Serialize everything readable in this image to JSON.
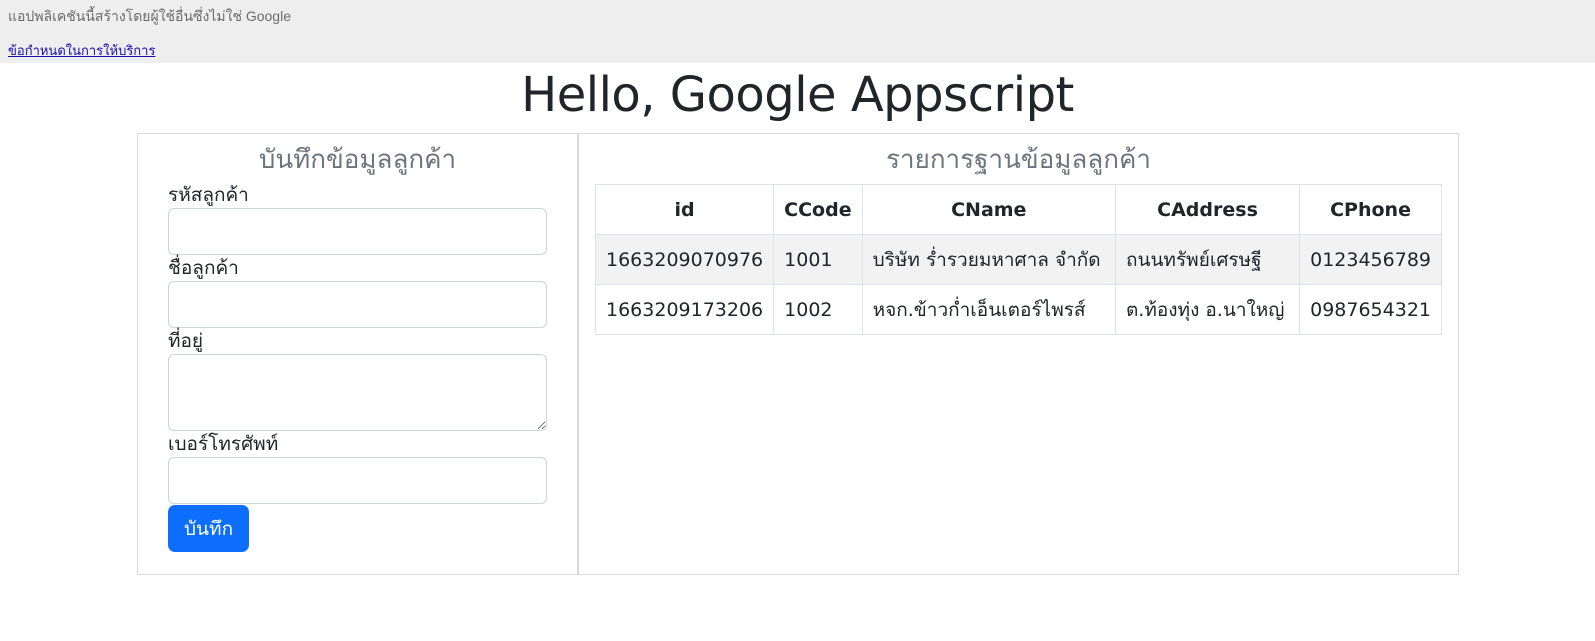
{
  "google_bar": {
    "notice": "แอปพลิเคชันนี้สร้างโดยผู้ใช้อื่นซึ่งไม่ใช่ Google",
    "terms_link": "ข้อกำหนดในการให้บริการ"
  },
  "page": {
    "title": "Hello, Google Appscript"
  },
  "form": {
    "title": "บันทึกข้อมูลลูกค้า",
    "fields": [
      {
        "label": "รหัสลูกค้า",
        "value": ""
      },
      {
        "label": "ชื่อลูกค้า",
        "value": ""
      },
      {
        "label": "ที่อยู่",
        "value": ""
      },
      {
        "label": "เบอร์โทรศัพท์",
        "value": ""
      }
    ],
    "submit_label": "บันทึก"
  },
  "customer_list": {
    "title": "รายการฐานข้อมูลลูกค้า",
    "columns": [
      "id",
      "CCode",
      "CName",
      "CAddress",
      "CPhone"
    ],
    "rows": [
      [
        "1663209070976",
        "1001",
        "บริษัท ร่ำรวยมหาศาล จำกัด",
        "ถนนทรัพย์เศรษฐี",
        "0123456789"
      ],
      [
        "1663209173206",
        "1002",
        "หจก.ข้าวก่ำเอ็นเตอร์ไพรส์",
        "ต.ท้องทุ่ง อ.นาใหญ่",
        "0987654321"
      ]
    ]
  }
}
